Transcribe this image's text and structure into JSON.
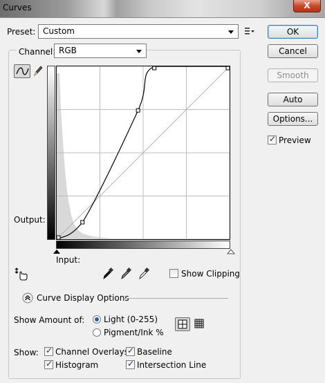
{
  "window": {
    "title": "Curves",
    "close_label": "X"
  },
  "preset": {
    "label": "Preset:",
    "value": "Custom"
  },
  "channel": {
    "label": "Channel:",
    "value": "RGB"
  },
  "buttons": {
    "ok": "OK",
    "cancel": "Cancel",
    "smooth": "Smooth",
    "auto": "Auto",
    "options": "Options..."
  },
  "preview": {
    "label": "Preview",
    "checked": true
  },
  "graph": {
    "output_label": "Output:",
    "input_label": "Input:",
    "curve_points": [
      [
        0,
        0
      ],
      [
        38,
        25
      ],
      [
        120,
        190
      ],
      [
        144,
        255
      ],
      [
        255,
        255
      ]
    ]
  },
  "show_clipping": {
    "label": "Show Clipping",
    "checked": false
  },
  "curve_display": {
    "header": "Curve Display Options",
    "show_amount_label": "Show Amount of:",
    "light_label": "Light  (0-255)",
    "pigment_label": "Pigment/Ink %",
    "selected_amount": "light",
    "show_label": "Show:",
    "channel_overlays": "Channel Overlays",
    "baseline": "Baseline",
    "histogram": "Histogram",
    "intersection_line": "Intersection Line"
  }
}
